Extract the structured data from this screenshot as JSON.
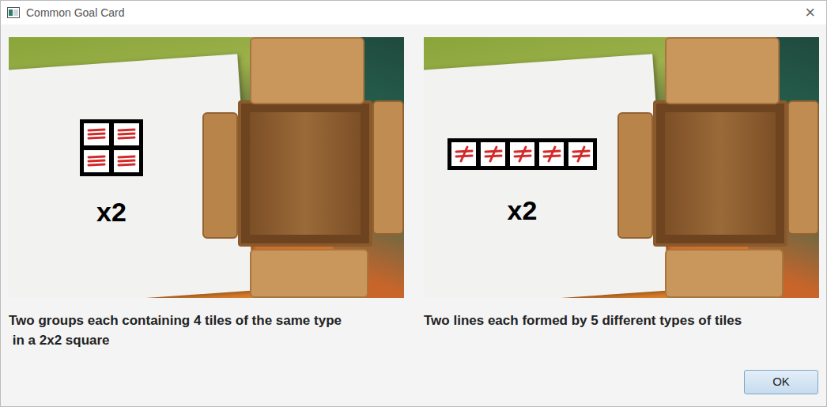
{
  "window": {
    "title": "Common Goal Card",
    "close": "×"
  },
  "cards": [
    {
      "kind": "square",
      "multiplier": "x2",
      "description": "Two groups each containing 4 tiles of the same type\n in a 2x2 square"
    },
    {
      "kind": "row",
      "multiplier": "x2",
      "description": "Two lines each formed by 5 different types of tiles"
    }
  ],
  "buttons": [
    {
      "label": "OK"
    }
  ]
}
